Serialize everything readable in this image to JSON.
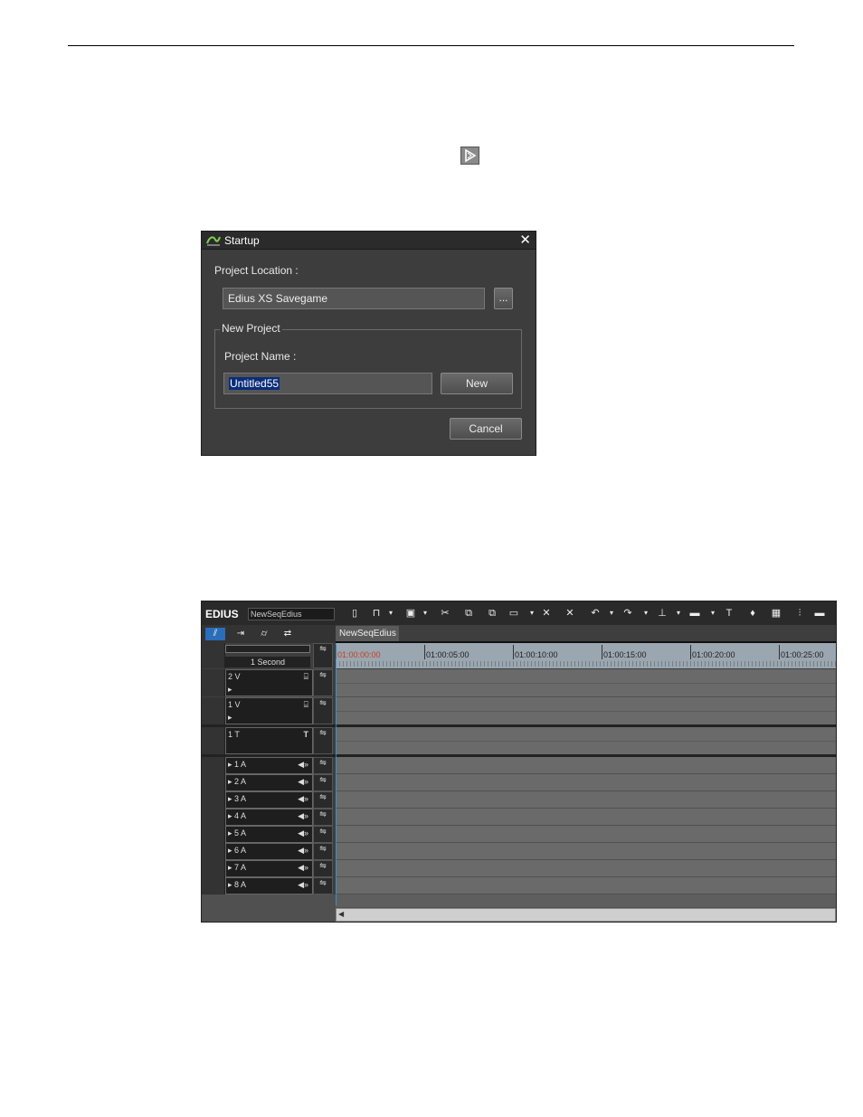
{
  "startup_dialog": {
    "title": "Startup",
    "close_glyph": "✕",
    "project_location_label": "Project Location :",
    "project_location_value": "Edius XS Savegame",
    "browse_label": "...",
    "new_project_group": "New Project",
    "project_name_label": "Project Name :",
    "project_name_value": "Untitled55",
    "new_button": "New",
    "cancel_button": "Cancel"
  },
  "timeline": {
    "brand": "EDIUS",
    "sequence_name": "NewSeqEdius",
    "sequence_tab": "NewSeqEdius",
    "zoom_label": "1 Second",
    "timecodes": [
      "01:00:00:00",
      "01:00:05:00",
      "01:00:10:00",
      "01:00:15:00",
      "01:00:20:00",
      "01:00:25:00"
    ],
    "toolbar_icons": [
      "new-icon",
      "open-icon",
      "save-icon",
      "cut-icon",
      "copy-icon",
      "paste-icon",
      "replace-icon",
      "delete-icon",
      "ripple-delete-icon",
      "undo-icon",
      "redo-icon",
      "insert-icon",
      "overwrite-icon",
      "title-icon",
      "mic-icon",
      "layout-icon",
      "mixer-icon",
      "window-icon"
    ],
    "tracks": {
      "video": [
        {
          "name": "2 V",
          "icon": "⌸"
        },
        {
          "name": "1 V",
          "icon": "⌸"
        }
      ],
      "title": [
        {
          "name": "1 T",
          "icon": "T"
        }
      ],
      "audio": [
        {
          "name": "1 A",
          "icon": "◀»"
        },
        {
          "name": "2 A",
          "icon": "◀»"
        },
        {
          "name": "3 A",
          "icon": "◀»"
        },
        {
          "name": "4 A",
          "icon": "◀»"
        },
        {
          "name": "5 A",
          "icon": "◀»"
        },
        {
          "name": "6 A",
          "icon": "◀»"
        },
        {
          "name": "7 A",
          "icon": "◀»"
        },
        {
          "name": "8 A",
          "icon": "◀»"
        }
      ]
    }
  }
}
